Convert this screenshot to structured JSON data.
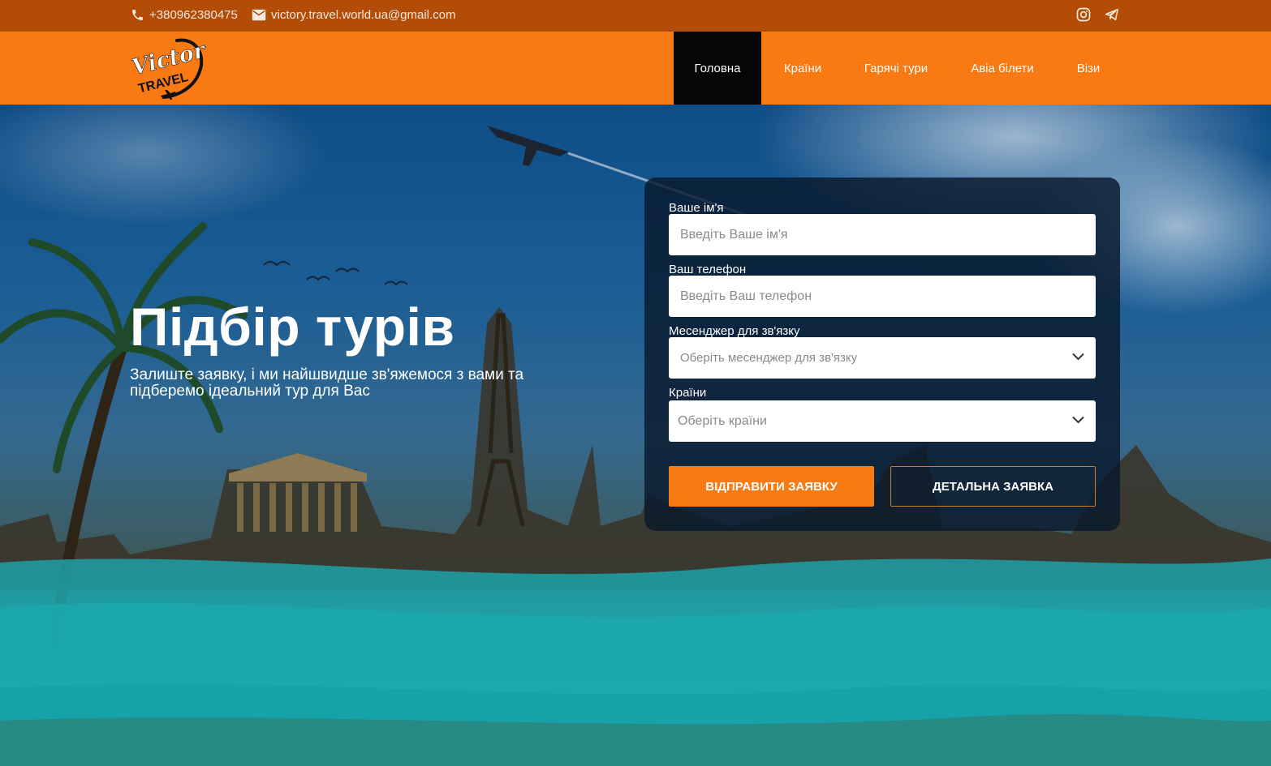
{
  "topbar": {
    "phone": "+380962380475",
    "email": "victory.travel.world.ua@gmail.com",
    "social": [
      "instagram-icon",
      "telegram-icon"
    ]
  },
  "header": {
    "logo_line1": "Victory",
    "logo_line2": "TRAVEL",
    "nav": [
      {
        "label": "Головна",
        "active": true
      },
      {
        "label": "Країни",
        "active": false
      },
      {
        "label": "Гарячі тури",
        "active": false
      },
      {
        "label": "Авіа білети",
        "active": false
      },
      {
        "label": "Візи",
        "active": false
      }
    ]
  },
  "hero": {
    "title": "Підбір турів",
    "subtitle": "Залиште заявку, і ми найшвидше зв'яжемося з вами та підберемо ідеальний тур для Вас"
  },
  "form": {
    "name_label": "Ваше ім'я",
    "name_placeholder": "Введіть Ваше ім'я",
    "phone_label": "Ваш телефон",
    "phone_placeholder": "Введіть Ваш телефон",
    "messenger_label": "Месенджер для зв'язку",
    "messenger_placeholder": "Оберіть месенджер для зв'язку",
    "countries_label": "Країни",
    "countries_placeholder": "Оберіть країни",
    "submit_label": "ВІДПРАВИТИ ЗАЯВКУ",
    "detailed_label": "ДЕТАЛЬНА ЗАЯВКА"
  },
  "colors": {
    "topbar": "#b24c07",
    "header": "#f97912",
    "nav_active": "#050505",
    "accent": "#f97912"
  }
}
